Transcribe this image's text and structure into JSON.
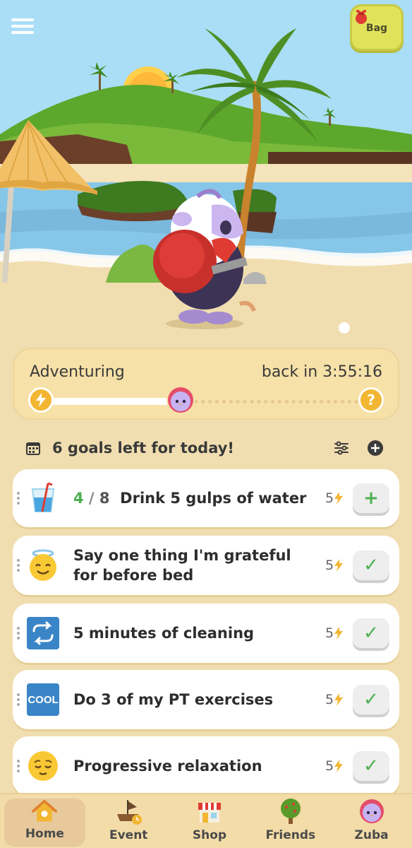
{
  "header": {
    "bag_label": "Bag"
  },
  "adventure": {
    "status": "Adventuring",
    "timer": "back in 3:55:16",
    "progress": 0.43,
    "end_marker": "?"
  },
  "goals": {
    "title": "6 goals left for today!",
    "items": [
      {
        "icon": "water-glass-icon",
        "progress_done": "4",
        "progress_sep": " / ",
        "progress_total": "8",
        "label": "Drink 5 gulps of water",
        "energy": "5",
        "action": "+"
      },
      {
        "icon": "angel-smiley-icon",
        "label": "Say one thing I'm grateful for before bed",
        "energy": "5",
        "action": "✓"
      },
      {
        "icon": "repeat-icon",
        "label": "5 minutes of cleaning",
        "energy": "5",
        "action": "✓"
      },
      {
        "icon": "cool-badge-icon",
        "icon_text": "COOL",
        "label": "Do 3 of my PT exercises",
        "energy": "5",
        "action": "✓"
      },
      {
        "icon": "relieved-face-icon",
        "label": "Progressive relaxation",
        "energy": "5",
        "action": "✓"
      }
    ]
  },
  "nav": {
    "items": [
      {
        "label": "Home",
        "icon": "home-icon",
        "active": true
      },
      {
        "label": "Event",
        "icon": "ship-icon",
        "active": false
      },
      {
        "label": "Shop",
        "icon": "shop-icon",
        "active": false
      },
      {
        "label": "Friends",
        "icon": "tree-icon",
        "active": false
      },
      {
        "label": "Zuba",
        "icon": "pet-face-icon",
        "active": false
      }
    ]
  },
  "colors": {
    "sky": "#a9def6",
    "sand": "#f1deb0",
    "accent_green": "#4caf50",
    "energy_yellow": "#f2b632",
    "bag_button": "#e0e35a"
  }
}
